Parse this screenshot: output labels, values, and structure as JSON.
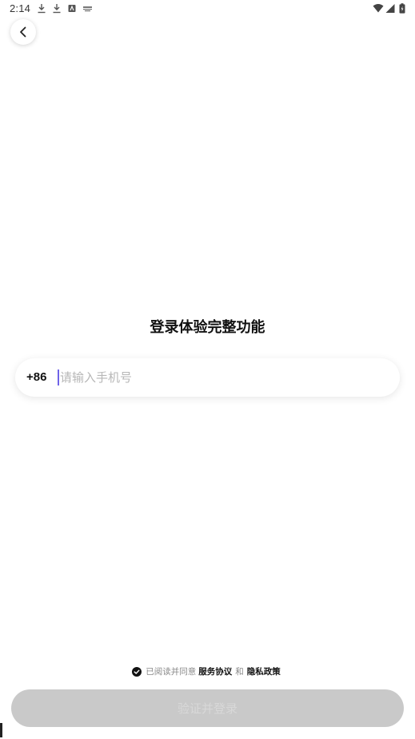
{
  "status_bar": {
    "time": "2:14",
    "notification_icons": [
      "download-icon",
      "download-icon",
      "app-notification-icon",
      "keyboard-icon"
    ],
    "right_icons": [
      "wifi-icon",
      "signal-icon",
      "battery-icon"
    ]
  },
  "title": "登录体验完整功能",
  "phone": {
    "country_code": "+86",
    "placeholder": "请输入手机号",
    "value": ""
  },
  "agreement": {
    "prefix": "已阅读并同意",
    "service_link": "服务协议",
    "and": "和",
    "privacy_link": "隐私政策",
    "checked": true
  },
  "submit_label": "验证并登录",
  "colors": {
    "accent_caret": "#6f63e8",
    "button_disabled": "#c9c9c9",
    "placeholder": "#b7b7b7"
  }
}
